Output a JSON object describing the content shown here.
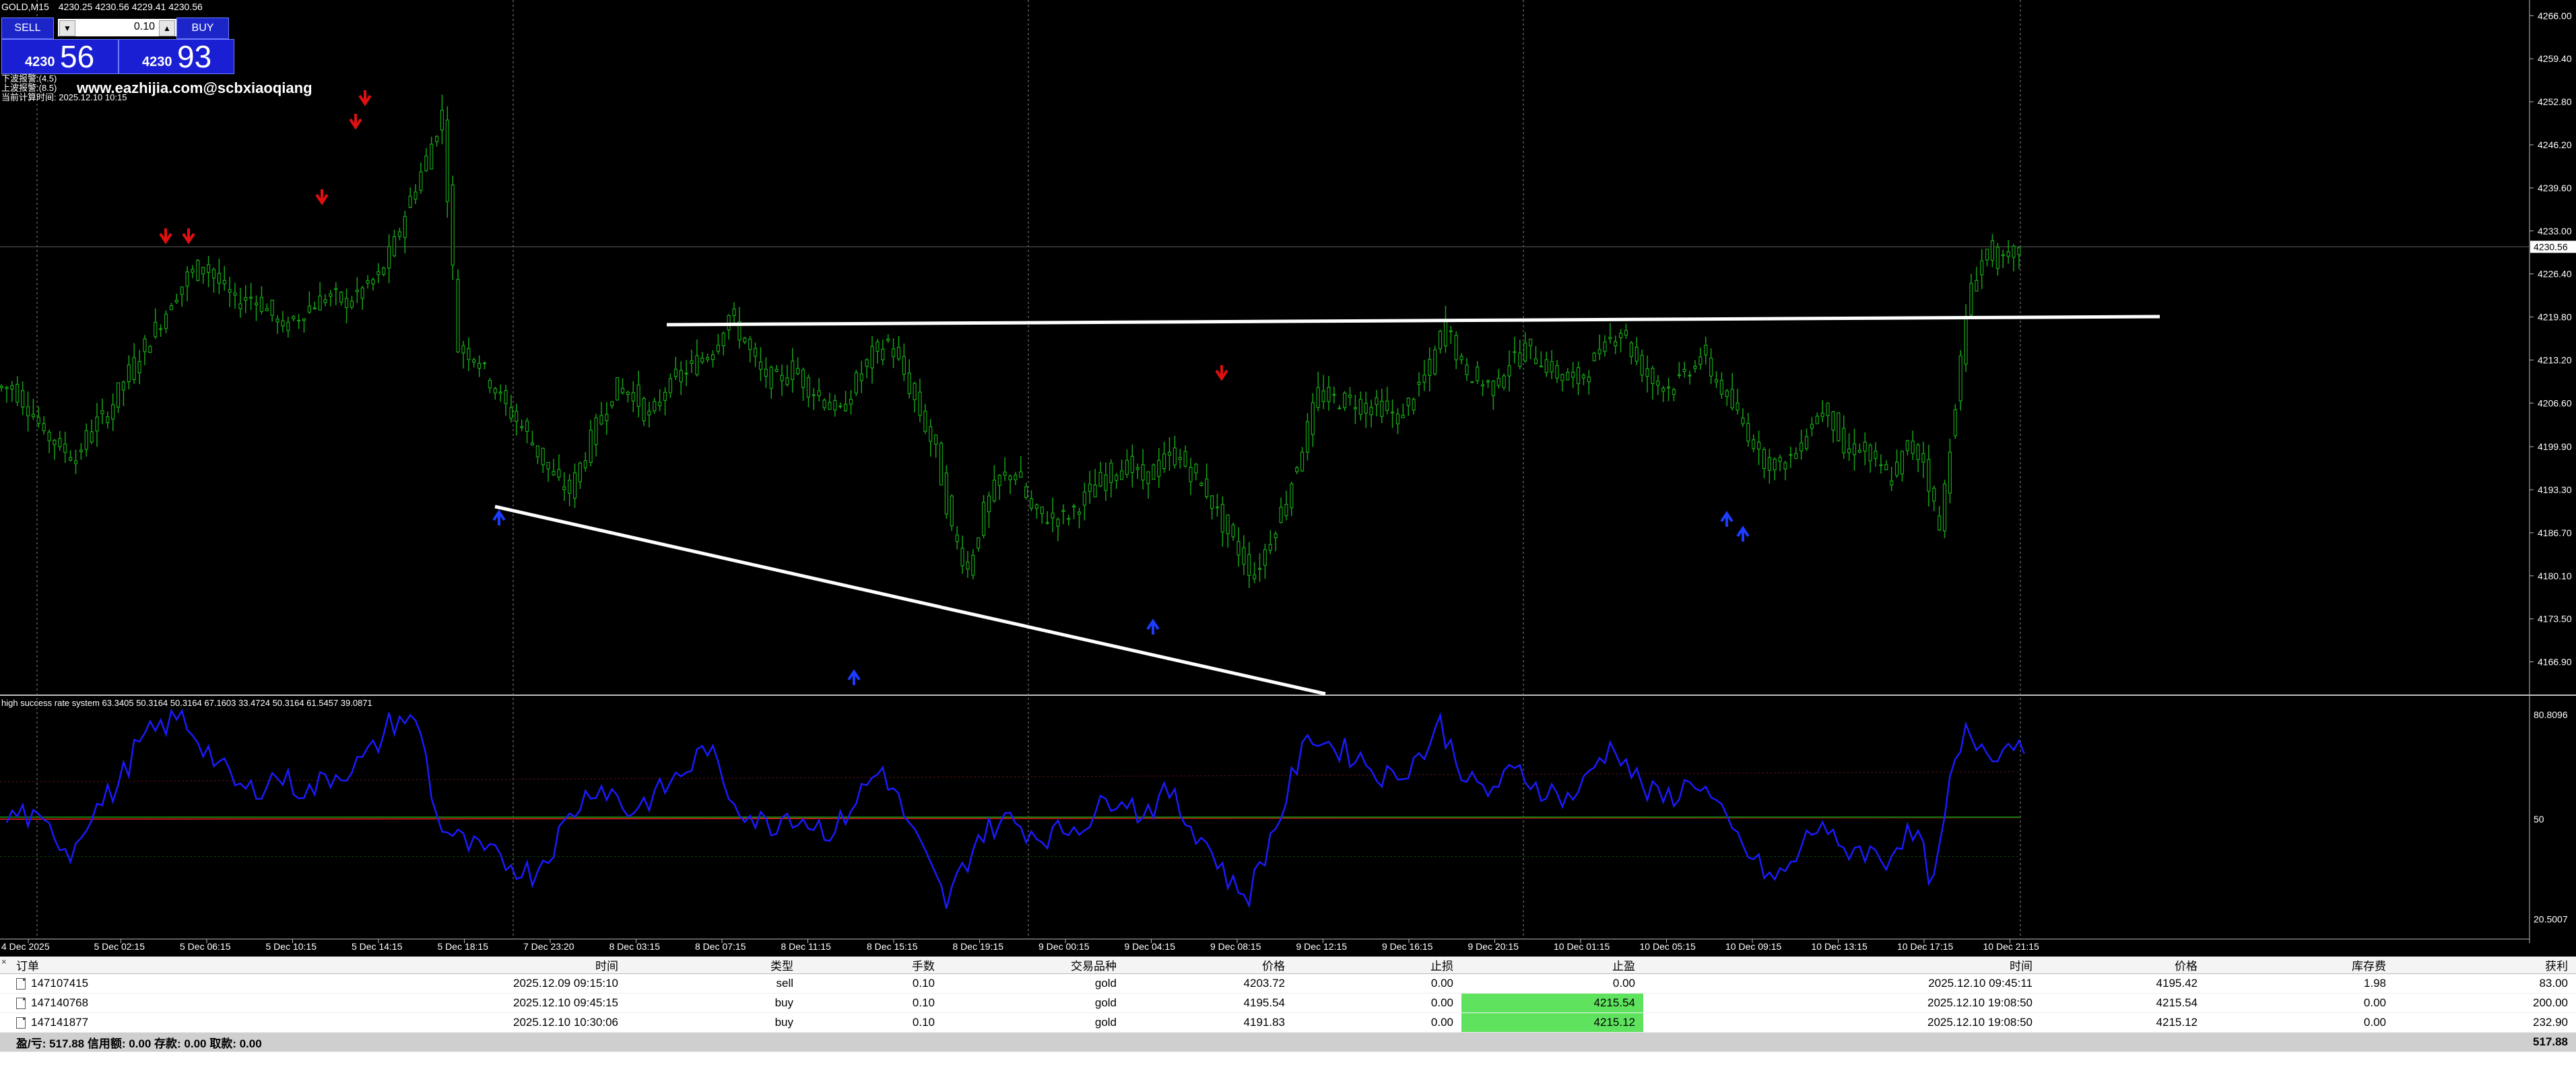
{
  "header": {
    "symbol": "GOLD,M15",
    "ohlc": "4230.25 4230.56 4229.41 4230.56"
  },
  "trade_panel": {
    "sell_label": "SELL",
    "buy_label": "BUY",
    "lot": "0.10",
    "sell_price_small": "4230",
    "sell_price_big": "56",
    "buy_price_small": "4230",
    "buy_price_big": "93"
  },
  "info_lines": [
    "下波报警:(4.5)",
    "上波报警:(8.5)",
    "当前计算时间: 2025.12.10 10:15"
  ],
  "watermark": "www.eazhijia.com@scbxiaoqiang",
  "indicator_label": "high success rate system 63.3405 50.3164 50.3164 67.1603 33.4724 50.3164 61.5457 39.0871",
  "colors": {
    "candle": "#16a316",
    "line": "#ffffff",
    "indicator": "#1a1aff",
    "mid_line": "#c81e1e",
    "arrow_down": "#e01010",
    "arrow_up": "#1c3cff",
    "current_line": "#5a5a5a"
  },
  "price_axis": [
    "4266.00",
    "4259.40",
    "4252.80",
    "4246.20",
    "4239.60",
    "4233.00",
    "4226.40",
    "4219.80",
    "4213.20",
    "4206.60",
    "4199.90",
    "4193.30",
    "4186.70",
    "4180.10",
    "4173.50",
    "4166.90"
  ],
  "current_price": "4230.56",
  "indicator_axis": [
    "80.8096",
    "50",
    "20.5007"
  ],
  "time_axis": [
    "4 Dec 2025",
    "5 Dec 02:15",
    "5 Dec 06:15",
    "5 Dec 10:15",
    "5 Dec 14:15",
    "5 Dec 18:15",
    "7 Dec 23:20",
    "8 Dec 03:15",
    "8 Dec 07:15",
    "8 Dec 11:15",
    "8 Dec 15:15",
    "8 Dec 19:15",
    "9 Dec 00:15",
    "9 Dec 04:15",
    "9 Dec 08:15",
    "9 Dec 12:15",
    "9 Dec 16:15",
    "9 Dec 20:15",
    "10 Dec 01:15",
    "10 Dec 05:15",
    "10 Dec 09:15",
    "10 Dec 13:15",
    "10 Dec 17:15",
    "10 Dec 21:15"
  ],
  "chart_data": {
    "type": "candlestick",
    "series": [
      {
        "name": "GOLD,M15",
        "values": [
          4209,
          4206,
          4202,
          4200,
          4198,
          4203,
          4205,
          4210,
          4214,
          4218,
          4222,
          4226,
          4228,
          4225,
          4222,
          4223,
          4221,
          4218,
          4220,
          4222,
          4223,
          4222,
          4224,
          4226,
          4231,
          4238,
          4244,
          4251,
          4215,
          4214,
          4210,
          4206,
          4203,
          4199,
          4195,
          4193,
          4199,
          4205,
          4209,
          4208,
          4204,
          4209,
          4211,
          4213,
          4215,
          4220,
          4216,
          4211,
          4210,
          4212,
          4209,
          4207,
          4205,
          4210,
          4214,
          4216,
          4211,
          4205,
          4199,
          4187,
          4181,
          4190,
          4195,
          4196,
          4190,
          4189,
          4189,
          4191,
          4194,
          4196,
          4197,
          4195,
          4197,
          4199,
          4196,
          4193,
          4188,
          4184,
          4180,
          4186,
          4192,
          4200,
          4208,
          4207,
          4207,
          4206,
          4206,
          4204,
          4208,
          4212,
          4219,
          4212,
          4210,
          4209,
          4213,
          4215,
          4213,
          4211,
          4210,
          4212,
          4216,
          4218,
          4213,
          4210,
          4209,
          4211,
          4214,
          4210,
          4206,
          4202,
          4198,
          4197,
          4199,
          4204,
          4206,
          4199,
          4200,
          4197,
          4195,
          4200,
          4198,
          4187,
          4207,
          4225,
          4230,
          4228,
          4230
        ]
      },
      {
        "name": "high success rate system",
        "values": [
          50,
          52,
          48,
          46,
          40,
          50,
          55,
          60,
          70,
          75,
          78,
          80,
          74,
          68,
          62,
          58,
          60,
          63,
          60,
          58,
          62,
          64,
          66,
          70,
          78,
          80,
          76,
          50,
          45,
          42,
          40,
          38,
          36,
          34,
          40,
          48,
          55,
          60,
          58,
          52,
          55,
          58,
          62,
          66,
          72,
          60,
          54,
          50,
          48,
          52,
          50,
          48,
          46,
          54,
          60,
          65,
          55,
          45,
          35,
          25,
          35,
          45,
          48,
          50,
          47,
          45,
          46,
          48,
          50,
          55,
          58,
          52,
          54,
          58,
          50,
          45,
          38,
          30,
          28,
          40,
          52,
          66,
          75,
          72,
          70,
          68,
          64,
          62,
          66,
          70,
          78,
          68,
          60,
          58,
          62,
          64,
          60,
          58,
          56,
          60,
          68,
          72,
          64,
          58,
          56,
          58,
          62,
          56,
          48,
          42,
          36,
          32,
          36,
          44,
          50,
          40,
          42,
          40,
          38,
          45,
          44,
          30,
          60,
          75,
          72,
          70,
          73
        ]
      }
    ],
    "xlabel": "",
    "ylabel": "",
    "ylim": [
      4162.0,
      4268.0
    ],
    "grid": false
  },
  "panel": {
    "columns": [
      "订单",
      "时间",
      "类型",
      "手数",
      "交易品种",
      "价格",
      "止损",
      "止盈",
      "时间",
      "价格",
      "库存费",
      "获利"
    ],
    "rows": [
      [
        "147107415",
        "2025.12.09 09:15:10",
        "sell",
        "0.10",
        "gold",
        "4203.72",
        "0.00",
        "0.00",
        "2025.12.10 09:45:11",
        "4195.42",
        "1.98",
        "83.00"
      ],
      [
        "147140768",
        "2025.12.10 09:45:15",
        "buy",
        "0.10",
        "gold",
        "4195.54",
        "0.00",
        "4215.54",
        "2025.12.10 19:08:50",
        "4215.54",
        "0.00",
        "200.00"
      ],
      [
        "147141877",
        "2025.12.10 10:30:06",
        "buy",
        "0.10",
        "gold",
        "4191.83",
        "0.00",
        "4215.12",
        "2025.12.10 19:08:50",
        "4215.12",
        "0.00",
        "232.90"
      ]
    ],
    "total_label": "盈/亏: 517.88  信用额: 0.00  存款: 0.00  取款: 0.00",
    "total_value": "517.88"
  }
}
